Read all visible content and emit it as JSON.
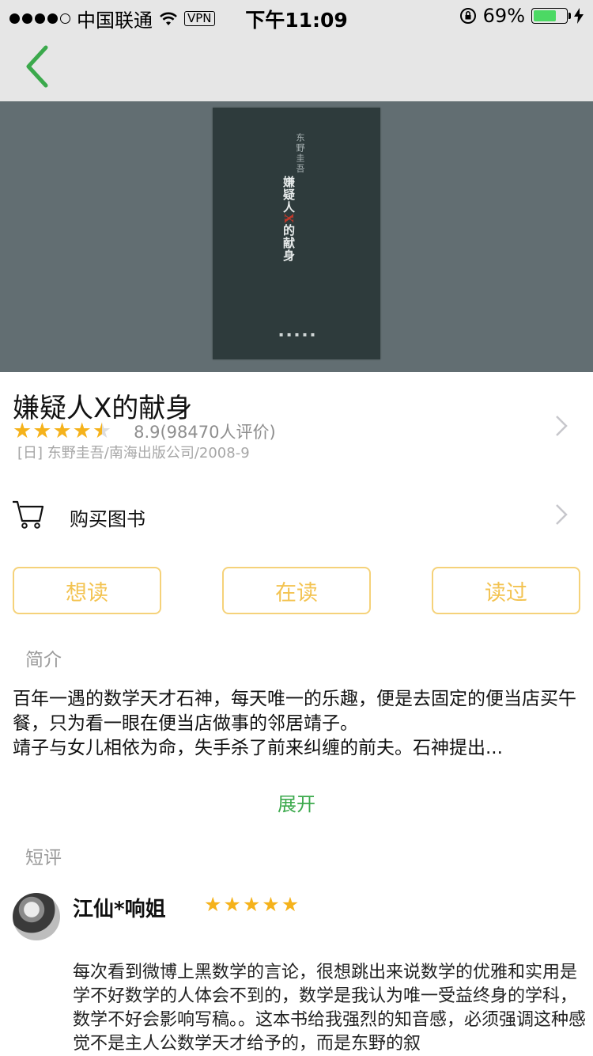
{
  "status_bar": {
    "carrier": "中国联通",
    "vpn": "VPN",
    "time": "下午11:09",
    "battery_pct_text": "69%",
    "battery_level": 0.69
  },
  "book": {
    "title": "嫌疑人X的献身",
    "rating_value": 4.5,
    "rating_text": "8.9(98470人评价)",
    "meta": "[日] 东野圭吾/南海出版公司/2008-9",
    "cover": {
      "author": "东野圭吾",
      "title_top": "嫌疑人",
      "title_x": "X",
      "title_bottom": "的献身"
    }
  },
  "buy": {
    "label": "购买图书"
  },
  "status_buttons": [
    "想读",
    "在读",
    "读过"
  ],
  "intro": {
    "label": "简介",
    "text": "百年一遇的数学天才石神，每天唯一的乐趣，便是去固定的便当店买午餐，只为看一眼在便当店做事的邻居靖子。\n靖子与女儿相依为命，失手杀了前来纠缠的前夫。石神提出...",
    "expand": "展开"
  },
  "short_review": {
    "label": "短评",
    "reviewer": "江仙*响姐",
    "stars": 5,
    "text": "每次看到微博上黑数学的言论，很想跳出来说数学的优雅和实用是学不好数学的人体会不到的，数学是我认为唯一受益终身的学科，数学不好会影响写稿。。这本书给我强烈的知音感，必须强调这种感觉不是主人公数学天才给予的，而是东野的叙"
  },
  "colors": {
    "accent_green": "#3ba94c",
    "star": "#f5b21b",
    "button_border": "#f5d27a",
    "button_text": "#f3c351",
    "cover_bg": "#626e72"
  },
  "icons": {
    "back": "chevron-left-icon",
    "cart": "cart-icon",
    "chevron": "chevron-right-icon",
    "wifi": "wifi-icon",
    "lock": "rotation-lock-icon",
    "charging": "bolt-icon"
  }
}
